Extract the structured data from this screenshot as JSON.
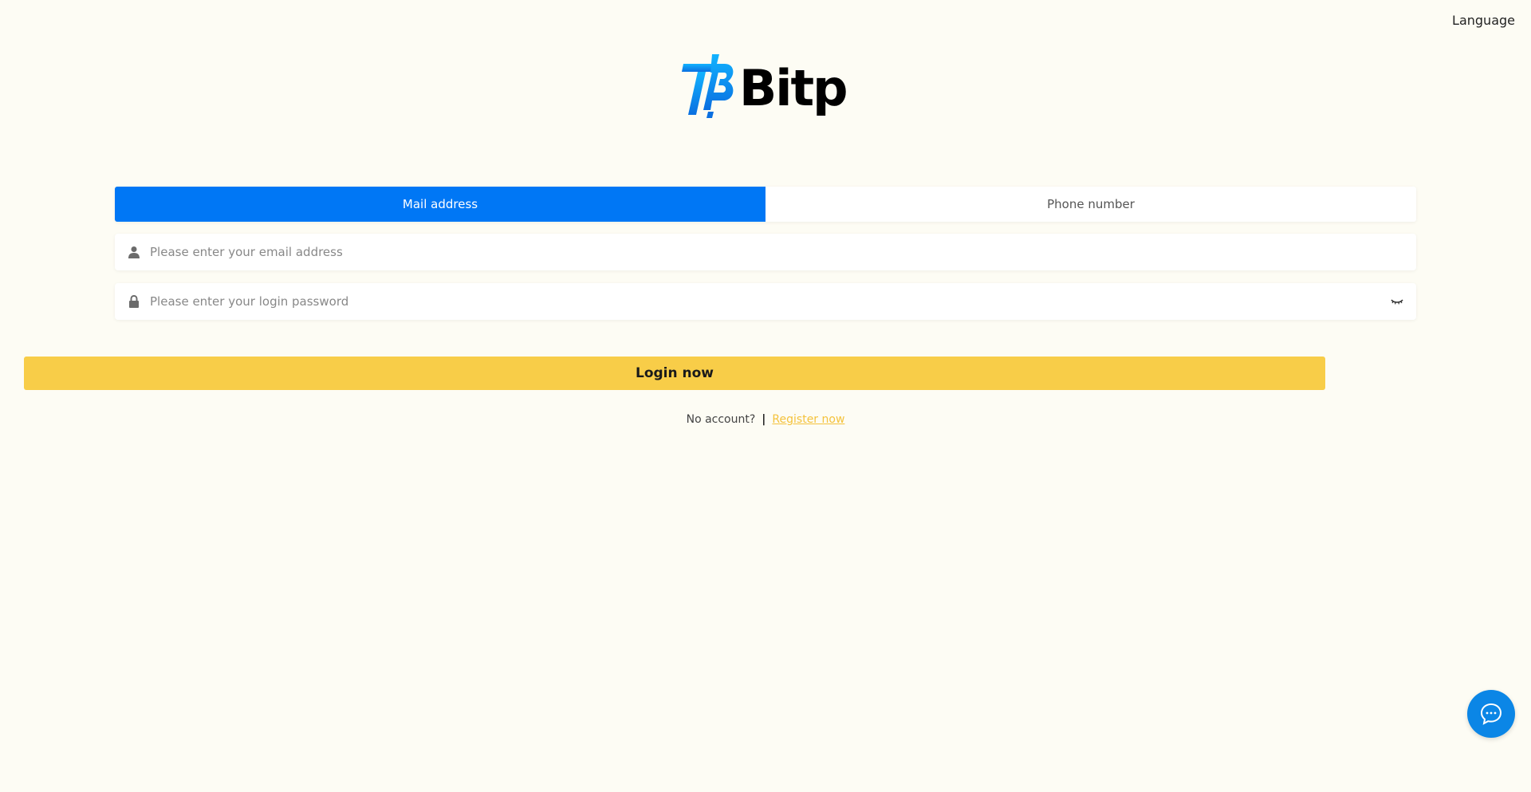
{
  "header": {
    "language_label": "Language"
  },
  "logo": {
    "text": "Bitp",
    "brand_color": "#0a8de8"
  },
  "tabs": [
    {
      "label": "Mail address",
      "active": true
    },
    {
      "label": "Phone number",
      "active": false
    }
  ],
  "form": {
    "email_placeholder": "Please enter your email address",
    "email_value": "",
    "password_placeholder": "Please enter your login password",
    "password_value": "",
    "login_label": "Login now"
  },
  "register": {
    "prompt": "No account?",
    "separator": "|",
    "link_label": "Register now"
  },
  "colors": {
    "background": "#fdfcf4",
    "tab_active": "#0077f5",
    "login_button": "#f8cd48",
    "register_link": "#f4c23c",
    "chat_button": "#0b86e6"
  },
  "icons": {
    "email_field": "user-icon",
    "password_field": "lock-icon",
    "password_toggle": "eye-closed-icon",
    "chat": "chat-bubble-icon"
  }
}
